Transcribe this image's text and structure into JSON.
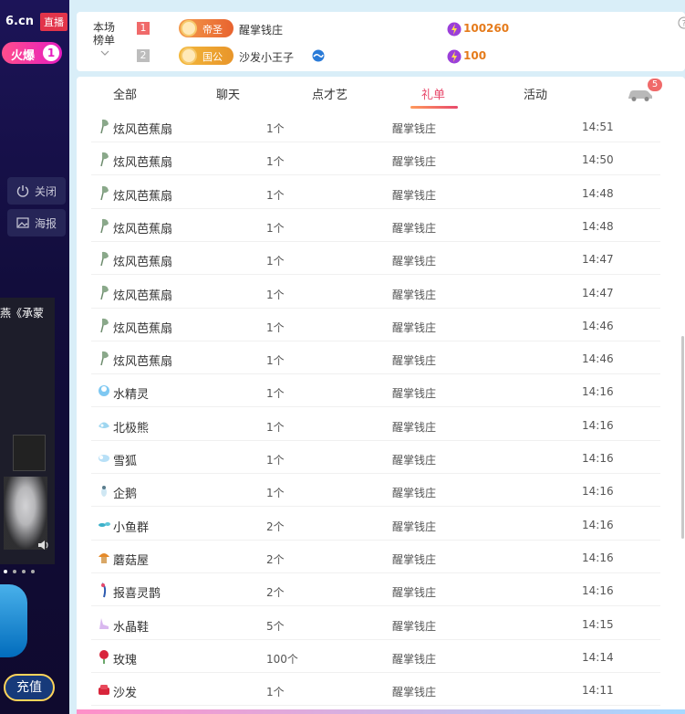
{
  "brand": {
    "logo": "6.cn",
    "live": "直播"
  },
  "hot": {
    "label": "火爆",
    "rank": "1"
  },
  "side": {
    "close": "关闭",
    "poster": "海报"
  },
  "video": {
    "caption": "燕《承蒙"
  },
  "recharge": "充值",
  "ranking": {
    "title": "本场榜单",
    "rows": [
      {
        "no": "1",
        "badge": "帝圣",
        "name": "醒掌钱庄",
        "amount": "100260"
      },
      {
        "no": "2",
        "badge": "国公",
        "name": "沙发小王子",
        "amount": "100"
      }
    ]
  },
  "tabs": [
    {
      "label": "全部"
    },
    {
      "label": "聊天"
    },
    {
      "label": "点才艺"
    },
    {
      "label": "礼单",
      "active": true
    },
    {
      "label": "活动"
    }
  ],
  "car_badge": "5",
  "gifts": [
    {
      "name": "炫风芭蕉扇",
      "qty": "1个",
      "from": "醒掌钱庄",
      "time": "14:51",
      "icon": "fan-icon"
    },
    {
      "name": "炫风芭蕉扇",
      "qty": "1个",
      "from": "醒掌钱庄",
      "time": "14:50",
      "icon": "fan-icon"
    },
    {
      "name": "炫风芭蕉扇",
      "qty": "1个",
      "from": "醒掌钱庄",
      "time": "14:48",
      "icon": "fan-icon"
    },
    {
      "name": "炫风芭蕉扇",
      "qty": "1个",
      "from": "醒掌钱庄",
      "time": "14:48",
      "icon": "fan-icon"
    },
    {
      "name": "炫风芭蕉扇",
      "qty": "1个",
      "from": "醒掌钱庄",
      "time": "14:47",
      "icon": "fan-icon"
    },
    {
      "name": "炫风芭蕉扇",
      "qty": "1个",
      "from": "醒掌钱庄",
      "time": "14:47",
      "icon": "fan-icon"
    },
    {
      "name": "炫风芭蕉扇",
      "qty": "1个",
      "from": "醒掌钱庄",
      "time": "14:46",
      "icon": "fan-icon"
    },
    {
      "name": "炫风芭蕉扇",
      "qty": "1个",
      "from": "醒掌钱庄",
      "time": "14:46",
      "icon": "fan-icon"
    },
    {
      "name": "水精灵",
      "qty": "1个",
      "from": "醒掌钱庄",
      "time": "14:16",
      "icon": "water-spirit-icon"
    },
    {
      "name": "北极熊",
      "qty": "1个",
      "from": "醒掌钱庄",
      "time": "14:16",
      "icon": "polar-bear-icon"
    },
    {
      "name": "雪狐",
      "qty": "1个",
      "from": "醒掌钱庄",
      "time": "14:16",
      "icon": "snow-fox-icon"
    },
    {
      "name": "企鹅",
      "qty": "1个",
      "from": "醒掌钱庄",
      "time": "14:16",
      "icon": "penguin-icon"
    },
    {
      "name": "小鱼群",
      "qty": "2个",
      "from": "醒掌钱庄",
      "time": "14:16",
      "icon": "fish-icon"
    },
    {
      "name": "蘑菇屋",
      "qty": "2个",
      "from": "醒掌钱庄",
      "time": "14:16",
      "icon": "mushroom-house-icon"
    },
    {
      "name": "报喜灵鹊",
      "qty": "2个",
      "from": "醒掌钱庄",
      "time": "14:16",
      "icon": "magpie-icon"
    },
    {
      "name": "水晶鞋",
      "qty": "5个",
      "from": "醒掌钱庄",
      "time": "14:15",
      "icon": "crystal-shoe-icon"
    },
    {
      "name": "玫瑰",
      "qty": "100个",
      "from": "醒掌钱庄",
      "time": "14:14",
      "icon": "rose-icon"
    },
    {
      "name": "沙发",
      "qty": "1个",
      "from": "醒掌钱庄",
      "time": "14:11",
      "icon": "sofa-icon"
    }
  ]
}
